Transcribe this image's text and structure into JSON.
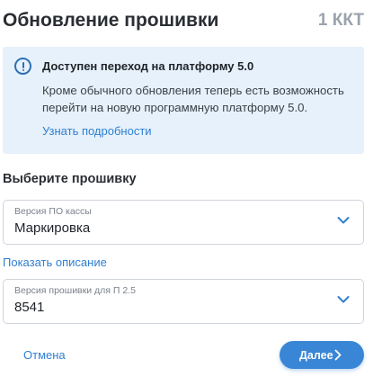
{
  "header": {
    "title": "Обновление прошивки",
    "count": "1 ККТ"
  },
  "info": {
    "title": "Доступен переход на платформу 5.0",
    "text": "Кроме обычного обновления теперь есть возможность перейти на новую программную платформу 5.0.",
    "link": "Узнать подробности"
  },
  "section": {
    "title": "Выберите прошивку"
  },
  "select_version": {
    "label": "Версия ПО кассы",
    "value": "Маркировка"
  },
  "show_description": "Показать описание",
  "select_firmware": {
    "label": "Версия прошивки для П 2.5",
    "value": "8541"
  },
  "footer": {
    "cancel": "Отмена",
    "next": "Далее"
  },
  "colors": {
    "accent": "#3a86d6",
    "link": "#2f7fd0",
    "info_bg": "#e6f1fb"
  }
}
